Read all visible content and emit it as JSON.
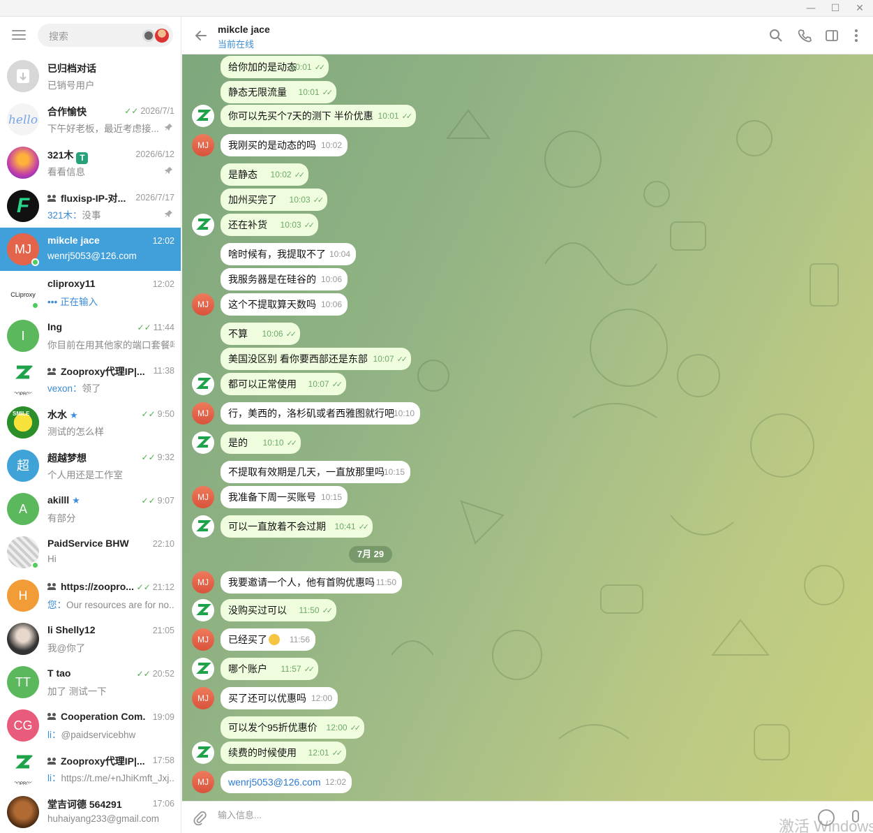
{
  "window": {
    "minimize": "—",
    "maximize": "☐",
    "close": "✕"
  },
  "sidebar": {
    "search_placeholder": "搜索",
    "chats": [
      {
        "name": "已归档对话",
        "preview": "已销号用户",
        "time": "",
        "avatar": "",
        "avatar_color": "#d7d7d7",
        "pinned": false,
        "read": false,
        "online": false,
        "group": false
      },
      {
        "name": "合作愉快",
        "preview": "下午好老板，最近考虑接...",
        "time": "2026/7/1",
        "avatar": "hello",
        "avatar_color": "#f4f4f4",
        "pinned": true,
        "read": true,
        "online": false,
        "group": false
      },
      {
        "name": "321木",
        "preview": "看看信息",
        "time": "2026/6/12",
        "avatar": "",
        "avatar_color": "#7a3fd0",
        "pinned": true,
        "read": false,
        "online": false,
        "group": false,
        "badge": "T"
      },
      {
        "name": "fluxisp-IP-对...",
        "preview_sender": "321木",
        "preview": "没事",
        "time": "2026/7/17",
        "avatar": "F",
        "avatar_color": "#111111",
        "pinned": true,
        "read": false,
        "online": false,
        "group": true
      },
      {
        "name": "mikcle jace",
        "preview": "wenrj5053@126.com",
        "time": "12:02",
        "avatar": "MJ",
        "avatar_color": "#e3644a",
        "pinned": false,
        "read": false,
        "online": true,
        "group": false,
        "active": true
      },
      {
        "name": "cliproxy11",
        "preview": "正在输入",
        "typing_dots": "•••",
        "time": "12:02",
        "avatar": "CLiproxy",
        "avatar_color": "#ffffff",
        "pinned": false,
        "read": false,
        "online": true,
        "group": false
      },
      {
        "name": "Ing",
        "preview": "你目前在用其他家的端口套餐吗",
        "time": "11:44",
        "avatar": "I",
        "avatar_color": "#5cb85c",
        "pinned": false,
        "read": true,
        "online": false,
        "group": false
      },
      {
        "name": "Zooproxy代理IP|...",
        "preview_sender": "vexon",
        "preview": "领了",
        "time": "11:38",
        "avatar": "ZOOPROXY",
        "avatar_color": "#ffffff",
        "pinned": false,
        "read": false,
        "online": false,
        "group": true
      },
      {
        "name": "水水",
        "preview": "测试的怎么样",
        "time": "9:50",
        "avatar": "SMILE",
        "avatar_color": "#2a8f2a",
        "pinned": false,
        "read": true,
        "online": false,
        "group": false,
        "star": true
      },
      {
        "name": "超越梦想",
        "preview": "个人用还是工作室",
        "time": "9:32",
        "avatar": "超",
        "avatar_color": "#3fa3d8",
        "pinned": false,
        "read": true,
        "online": false,
        "group": false
      },
      {
        "name": "akilll",
        "preview": "有部分",
        "time": "9:07",
        "avatar": "A",
        "avatar_color": "#5cb85c",
        "pinned": false,
        "read": true,
        "online": false,
        "group": false,
        "star": true
      },
      {
        "name": "PaidService BHW",
        "preview": "Hi",
        "time": "22:10",
        "avatar": "",
        "avatar_color": "#bbbbbb",
        "pinned": false,
        "read": false,
        "online": true,
        "group": false
      },
      {
        "name": "https://zoopro...",
        "preview_sender": "您",
        "preview": "Our resources are for no...",
        "time": "21:12",
        "avatar": "H",
        "avatar_color": "#f29c38",
        "pinned": false,
        "read": true,
        "online": false,
        "group": true
      },
      {
        "name": "li Shelly12",
        "preview": "我@你了",
        "time": "21:05",
        "avatar": "",
        "avatar_color": "#555555",
        "pinned": false,
        "read": false,
        "online": false,
        "group": false
      },
      {
        "name": "T tao",
        "preview": "加了 测试一下",
        "time": "20:52",
        "avatar": "TT",
        "avatar_color": "#5cb85c",
        "pinned": false,
        "read": true,
        "online": false,
        "group": false
      },
      {
        "name": "Cooperation Com...",
        "preview_sender": "li",
        "preview": "@paidservicebhw",
        "time": "19:09",
        "avatar": "CG",
        "avatar_color": "#e85b7a",
        "pinned": false,
        "read": false,
        "online": false,
        "group": true
      },
      {
        "name": "Zooproxy代理IP|...",
        "preview_sender": "li",
        "preview": "https://t.me/+nJhiKmft_Jxj...",
        "time": "17:58",
        "avatar": "ZOOPROXY",
        "avatar_color": "#ffffff",
        "pinned": false,
        "read": false,
        "online": false,
        "group": true
      },
      {
        "name": "堂吉诃德 564291",
        "preview": "huhaiyang233@gmail.com",
        "time": "17:06",
        "avatar": "",
        "avatar_color": "#6b3a1f",
        "pinned": false,
        "read": false,
        "online": false,
        "group": false
      }
    ]
  },
  "header": {
    "name": "mikcle jace",
    "status": "当前在线"
  },
  "messages": [
    {
      "text": "给你加的是动态",
      "time": "10:01",
      "dir": "out"
    },
    {
      "text": "静态无限流量",
      "time": "10:01",
      "dir": "out"
    },
    {
      "text": "你可以先买个7天的测下 半价优惠",
      "time": "10:01",
      "dir": "out"
    },
    {
      "text": "我刚买的是动态的吗",
      "time": "10:02",
      "dir": "in"
    },
    {
      "text": "是静态",
      "time": "10:02",
      "dir": "out"
    },
    {
      "text": "加州买完了",
      "time": "10:03",
      "dir": "out"
    },
    {
      "text": "还在补货",
      "time": "10:03",
      "dir": "out"
    },
    {
      "text": "啥时候有，我提取不了",
      "time": "10:04",
      "dir": "in"
    },
    {
      "text": "我服务器是在硅谷的",
      "time": "10:06",
      "dir": "in"
    },
    {
      "text": "这个不提取算天数吗",
      "time": "10:06",
      "dir": "in"
    },
    {
      "text": "不算",
      "time": "10:06",
      "dir": "out"
    },
    {
      "text": "美国没区别 看你要西部还是东部",
      "time": "10:07",
      "dir": "out"
    },
    {
      "text": "都可以正常使用",
      "time": "10:07",
      "dir": "out"
    },
    {
      "text": "行，美西的，洛杉矶或者西雅图就行吧",
      "time": "10:10",
      "dir": "in"
    },
    {
      "text": "是的",
      "time": "10:10",
      "dir": "out"
    },
    {
      "text": "不提取有效期是几天，一直放那里吗",
      "time": "10:15",
      "dir": "in"
    },
    {
      "text": "我准备下周一买账号",
      "time": "10:15",
      "dir": "in"
    },
    {
      "text": "可以一直放着不会过期",
      "time": "10:41",
      "dir": "out"
    },
    {
      "text": "我要邀请一个人，他有首购优惠吗",
      "time": "11:50",
      "dir": "in"
    },
    {
      "text": "没购买过可以",
      "time": "11:50",
      "dir": "out"
    },
    {
      "text": "已经买了",
      "time": "11:56",
      "dir": "in",
      "emoji": "joy"
    },
    {
      "text": "哪个账户",
      "time": "11:57",
      "dir": "out"
    },
    {
      "text": "买了还可以优惠吗",
      "time": "12:00",
      "dir": "in"
    },
    {
      "text": "可以发个95折优惠价",
      "time": "12:00",
      "dir": "out"
    },
    {
      "text": "续费的时候使用",
      "time": "12:01",
      "dir": "out"
    },
    {
      "text": "wenrj5053@126.com",
      "time": "12:02",
      "dir": "in",
      "link": true
    }
  ],
  "date_separator": "7月 29",
  "composer": {
    "placeholder": "输入信息..."
  },
  "watermark": "激活 Windows",
  "colors": {
    "accent": "#419fd9",
    "out_bubble": "#effdde",
    "in_bubble": "#ffffff",
    "read_check": "#4fae4e"
  }
}
